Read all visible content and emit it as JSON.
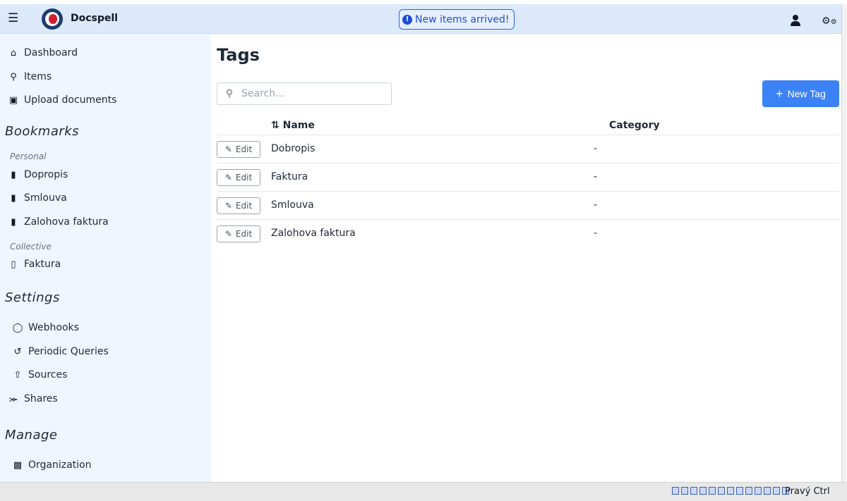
{
  "app": {
    "title": "Docspell"
  },
  "header": {
    "notice": "New items arrived!"
  },
  "sidebar": {
    "main": [
      {
        "label": "Dashboard",
        "icon": "home-icon"
      },
      {
        "label": "Items",
        "icon": "search-icon"
      },
      {
        "label": "Upload documents",
        "icon": "file-upload-icon"
      }
    ],
    "bookmarks_title": "Bookmarks",
    "personal_label": "Personal",
    "personal": [
      {
        "label": "Dopropis",
        "icon": "bookmark-icon"
      },
      {
        "label": "Smlouva",
        "icon": "bookmark-icon"
      },
      {
        "label": "Zalohova faktura",
        "icon": "bookmark-icon"
      }
    ],
    "collective_label": "Collective",
    "collective": [
      {
        "label": "Faktura",
        "icon": "bookmark-outline-icon"
      }
    ],
    "settings_title": "Settings",
    "settings": [
      {
        "label": "Webhooks",
        "icon": "comment-icon"
      },
      {
        "label": "Periodic Queries",
        "icon": "history-icon"
      },
      {
        "label": "Sources",
        "icon": "upload-icon"
      },
      {
        "label": "Shares",
        "icon": "share-icon"
      }
    ],
    "manage_title": "Manage",
    "manage": [
      {
        "label": "Organization",
        "icon": "industry-icon"
      }
    ]
  },
  "main": {
    "title": "Tags",
    "search_placeholder": "Search...",
    "new_button": "New Tag",
    "columns": {
      "name": "Name",
      "category": "Category"
    },
    "edit_label": "Edit",
    "rows": [
      {
        "name": "Dobropis",
        "category": "-"
      },
      {
        "name": "Faktura",
        "category": "-"
      },
      {
        "name": "Smlouva",
        "category": "-"
      },
      {
        "name": "Zalohova faktura",
        "category": "-"
      }
    ]
  },
  "statusbar": {
    "host_key": "Pravý Ctrl"
  },
  "colors": {
    "accent": "#3b82f6",
    "sidebar_bg": "#eff6ff",
    "header_bg": "#dbe9fb"
  }
}
